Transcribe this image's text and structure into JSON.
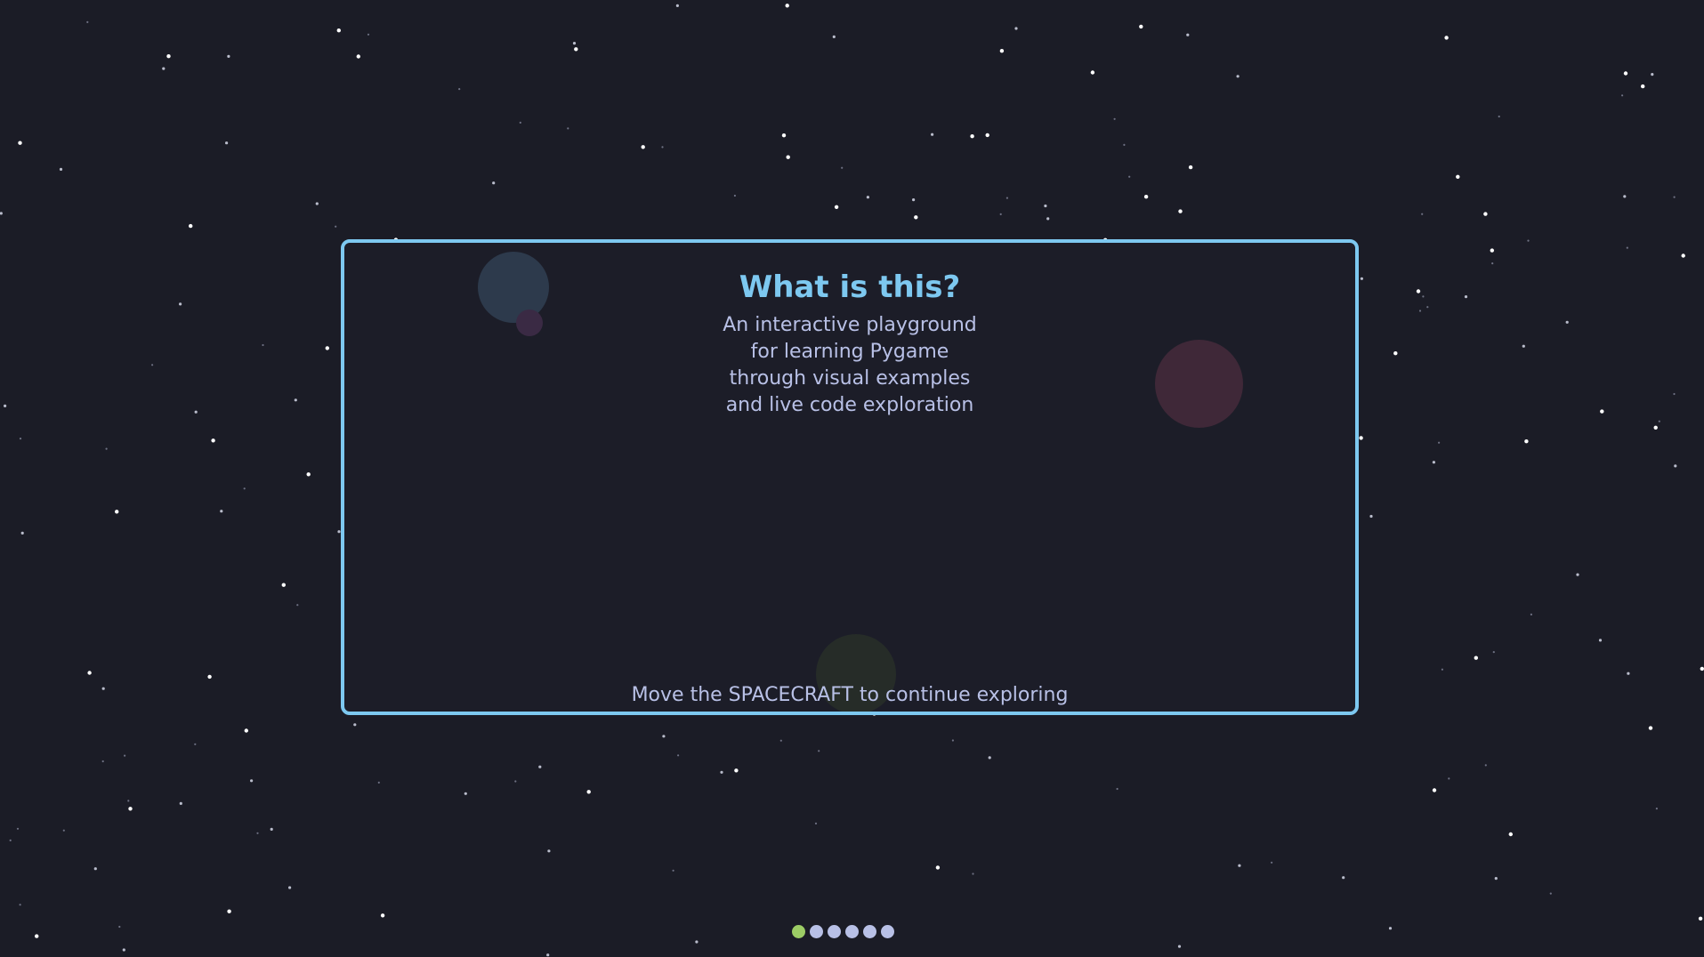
{
  "panel": {
    "title": "What is this?",
    "body_lines": [
      "An interactive playground",
      "for learning Pygame",
      "through visual examples",
      "and live code exploration"
    ],
    "hint": "Move the SPACECRAFT to continue exploring"
  },
  "pagination": {
    "total": 6,
    "current": 1
  },
  "colors": {
    "background": "#1b1c26",
    "accent": "#7dc8f0",
    "text": "#b8c0e6",
    "active_dot": "#9ccc65"
  }
}
